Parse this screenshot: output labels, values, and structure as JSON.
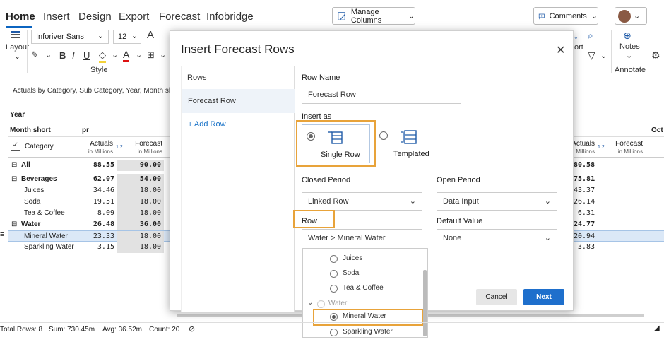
{
  "tabs": [
    "Home",
    "Insert",
    "Design",
    "Export",
    "Forecast",
    "Infobridge"
  ],
  "toolbar": {
    "manage_columns": "Manage Columns",
    "comments": "Comments",
    "font_family": "Inforiver Sans",
    "font_size": "12",
    "layout_label": "Layout",
    "style_label": "Style",
    "notes_label": "Notes",
    "annotate_label": "Annotate",
    "sort_fragment": "ort"
  },
  "subtitle": "Actuals by Category, Sub Category, Year, Month sh",
  "grid": {
    "year_label": "Year",
    "month_label": "Month short",
    "month_fragment": "pr",
    "oct_fragment": "Oct",
    "category_label": "Category",
    "col_actuals": "Actuals",
    "col_forecast": "Forecast",
    "col_sub": "in Millions",
    "col_sub_short": "Millions",
    "ratio_icon": "1.2",
    "rows": [
      {
        "label": "All",
        "actuals": "88.55",
        "forecast": "90.00",
        "right": "80.58",
        "group": true,
        "expander": "⊟"
      },
      {
        "label": "Beverages",
        "actuals": "62.07",
        "forecast": "54.00",
        "right": "75.81",
        "group": true,
        "expander": "⊟"
      },
      {
        "label": "Juices",
        "actuals": "34.46",
        "forecast": "18.00",
        "right": "43.37"
      },
      {
        "label": "Soda",
        "actuals": "19.51",
        "forecast": "18.00",
        "right": "26.14"
      },
      {
        "label": "Tea & Coffee",
        "actuals": "8.09",
        "forecast": "18.00",
        "right": "6.31"
      },
      {
        "label": "Water",
        "actuals": "26.48",
        "forecast": "36.00",
        "right": "24.77",
        "group": true,
        "expander": "⊟"
      },
      {
        "label": "Mineral Water",
        "actuals": "23.33",
        "forecast": "18.00",
        "right": "20.94",
        "selected": true
      },
      {
        "label": "Sparkling Water",
        "actuals": "3.15",
        "forecast": "18.00",
        "right": "3.83"
      }
    ]
  },
  "dialog": {
    "title": "Insert Forecast Rows",
    "rows_header": "Rows",
    "rows_item": "Forecast Row",
    "add_row": "+ Add Row",
    "row_name_label": "Row Name",
    "row_name_value": "Forecast Row",
    "insert_as_label": "Insert as",
    "single_row": "Single Row",
    "templated": "Templated",
    "closed_period_label": "Closed Period",
    "closed_period_value": "Linked Row",
    "open_period_label": "Open Period",
    "open_period_value": "Data Input",
    "row_label": "Row",
    "row_value": "Water > Mineral Water",
    "default_value_label": "Default Value",
    "default_value_value": "None",
    "cancel": "Cancel",
    "next": "Next"
  },
  "dropdown": {
    "items": [
      {
        "label": "Juices",
        "checked": false
      },
      {
        "label": "Soda",
        "checked": false
      },
      {
        "label": "Tea & Coffee",
        "checked": false
      },
      {
        "label": "Water",
        "group": true
      },
      {
        "label": "Mineral Water",
        "checked": true
      },
      {
        "label": "Sparkling Water",
        "checked": false
      }
    ]
  },
  "status": {
    "total_rows": "Total Rows: 8",
    "sum": "Sum: 730.45m",
    "avg": "Avg: 36.52m",
    "count": "Count: 20"
  },
  "colors": {
    "accent": "#1e6fcc",
    "highlight": "#e8a33a",
    "forecast_bg": "#e2e2e2"
  }
}
